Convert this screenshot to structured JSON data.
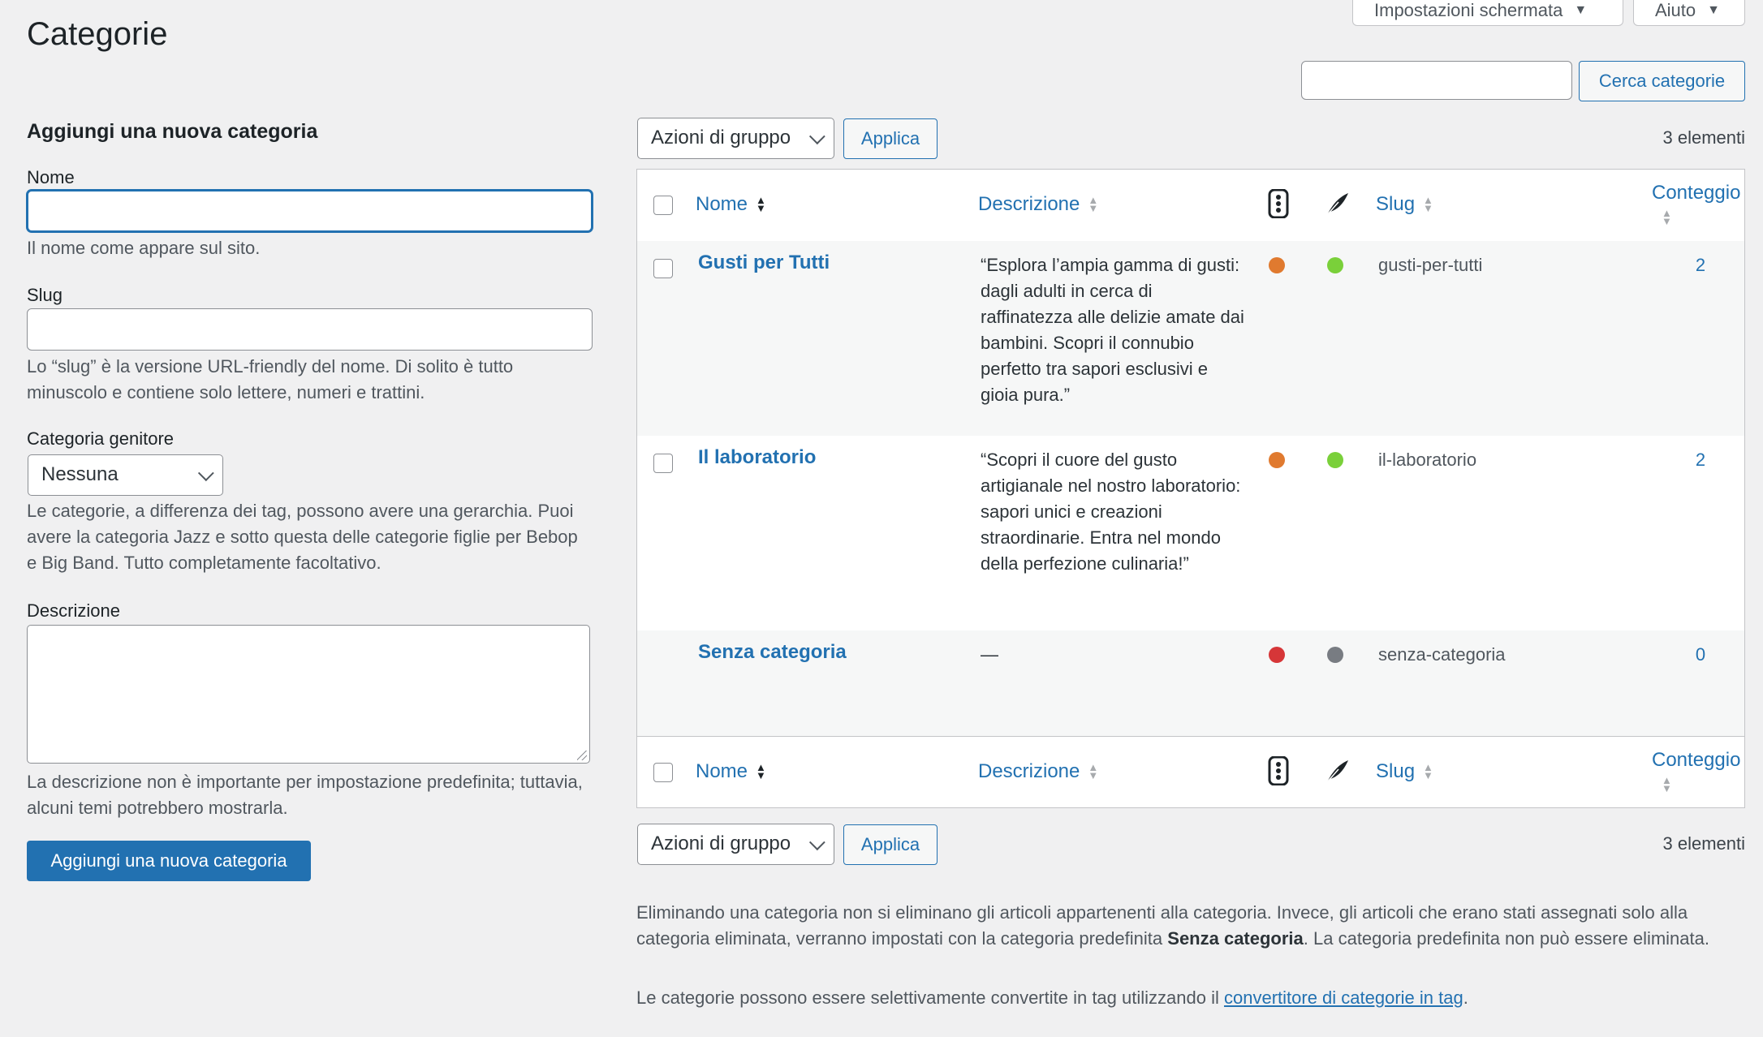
{
  "page": {
    "title": "Categorie"
  },
  "top_tabs": {
    "screen_options": "Impostazioni schermata",
    "help": "Aiuto"
  },
  "search": {
    "button": "Cerca categorie",
    "placeholder": ""
  },
  "form": {
    "heading": "Aggiungi una nuova categoria",
    "name_label": "Nome",
    "name_help": "Il nome come appare sul sito.",
    "slug_label": "Slug",
    "slug_help": "Lo “slug” è la versione URL-friendly del nome. Di solito è tutto minuscolo e contiene solo lettere, numeri e trattini.",
    "parent_label": "Categoria genitore",
    "parent_value": "Nessuna",
    "parent_help": "Le categorie, a differenza dei tag, possono avere una gerarchia. Puoi avere la categoria Jazz e sotto questa delle categorie figlie per Bebop e Big Band. Tutto completamente facoltativo.",
    "desc_label": "Descrizione",
    "desc_help": "La descrizione non è importante per impostazione predefinita; tuttavia, alcuni temi potrebbero mostrarla.",
    "submit": "Aggiungi una nuova categoria"
  },
  "bulk": {
    "select_value": "Azioni di gruppo",
    "apply": "Applica",
    "count": "3 elementi"
  },
  "table": {
    "columns": {
      "name": "Nome",
      "description": "Descrizione",
      "slug": "Slug",
      "count": "Conteggio"
    },
    "rows": [
      {
        "name": "Gusti per Tutti",
        "description": "“Esplora l’ampia gamma di gusti: dagli adulti in cerca di raffinatezza alle delizie amate dai bambini. Scopri il connubio perfetto tra sapori esclusivi e gioia pura.”",
        "slug": "gusti-per-tutti",
        "count": "2",
        "status1": "#e07a2f",
        "status2": "#7ad03a"
      },
      {
        "name": "Il laboratorio",
        "description": "“Scopri il cuore del gusto artigianale nel nostro laboratorio: sapori unici e creazioni straordinarie. Entra nel mondo della perfezione culinaria!”",
        "slug": "il-laboratorio",
        "count": "2",
        "status1": "#e07a2f",
        "status2": "#7ad03a"
      },
      {
        "name": "Senza categoria",
        "description": "—",
        "slug": "senza-categoria",
        "count": "0",
        "status1": "#d63638",
        "status2": "#787c82"
      }
    ]
  },
  "notes": {
    "line1_a": "Eliminando una categoria non si eliminano gli articoli appartenenti alla categoria. Invece, gli articoli che erano stati assegnati solo alla categoria eliminata, verranno impostati con la categoria predefinita ",
    "line1_bold": "Senza categoria",
    "line1_b": ". La categoria predefinita non può essere eliminata.",
    "line2_a": "Le categorie possono essere selettivamente convertite in tag utilizzando il ",
    "line2_link": "convertitore di categorie in tag",
    "line2_b": "."
  },
  "icons": {
    "traffic_light": "traffic-light-icon",
    "feather": "feather-icon"
  }
}
